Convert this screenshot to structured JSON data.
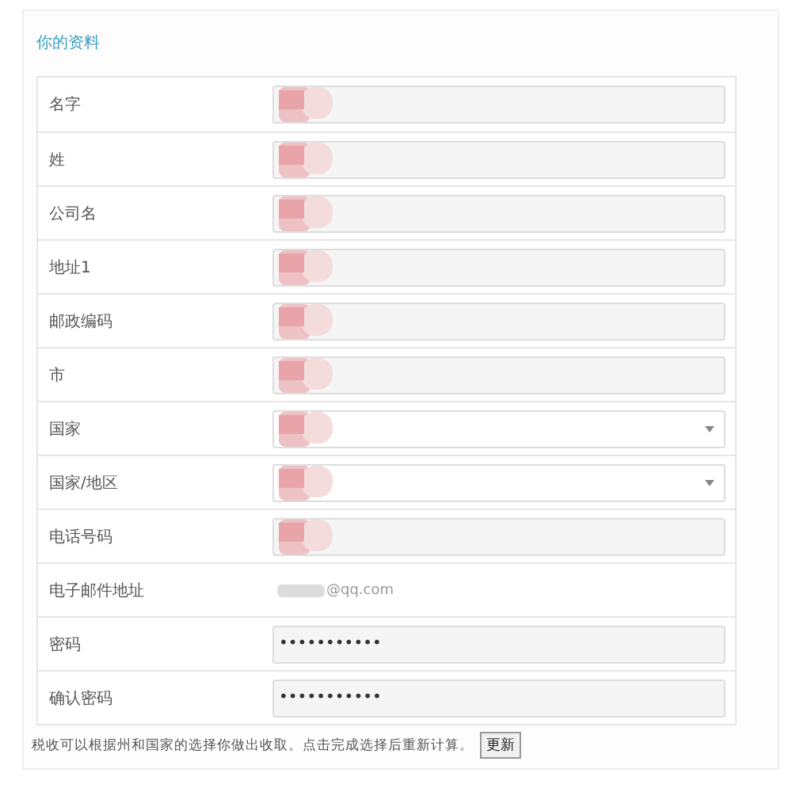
{
  "title": "你的资料",
  "rows": [
    {
      "label": "名字",
      "kind": "text",
      "redacted": true
    },
    {
      "label": "姓",
      "kind": "text",
      "redacted": true
    },
    {
      "label": "公司名",
      "kind": "text",
      "redacted": true
    },
    {
      "label": "地址1",
      "kind": "text",
      "redacted": true
    },
    {
      "label": "邮政编码",
      "kind": "text",
      "redacted": true
    },
    {
      "label": "市",
      "kind": "text",
      "redacted": true
    },
    {
      "label": "国家",
      "kind": "select",
      "redacted": true
    },
    {
      "label": "国家/地区",
      "kind": "select",
      "redacted": true
    },
    {
      "label": "电话号码",
      "kind": "text",
      "redacted": true
    },
    {
      "label": "电子邮件地址",
      "kind": "static",
      "value": "@qq.com",
      "redacted": true
    },
    {
      "label": "密码",
      "kind": "password",
      "value": "•••••••••••",
      "redacted": false
    },
    {
      "label": "确认密码",
      "kind": "password",
      "value": "•••••••••••",
      "redacted": false
    }
  ],
  "note": "税收可以根据州和国家的选择你做出收取。点击完成选择后重新计算。",
  "update_button": "更新"
}
